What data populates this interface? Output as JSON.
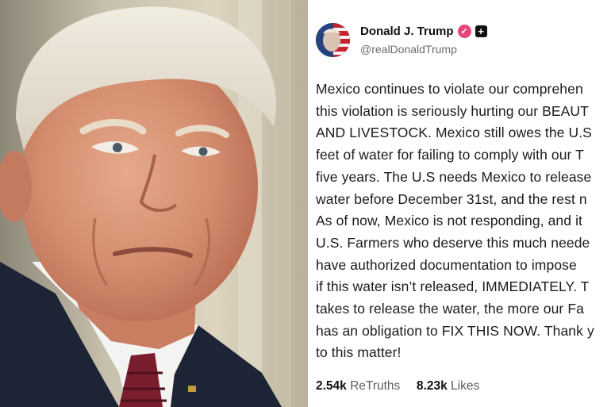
{
  "post": {
    "author_name": "Donald J. Trump",
    "handle": "@realDonaldTrump",
    "body_lines": [
      "Mexico continues to violate our comprehen",
      "this violation is seriously hurting our BEAUT",
      "AND LIVESTOCK. Mexico still owes the U.S",
      "feet of water for failing to comply with our T",
      "five years. The U.S needs Mexico to release",
      "water before December 31st, and the rest n",
      "As of now, Mexico is not responding, and it",
      "U.S. Farmers who deserve this much neede",
      "have authorized documentation to impose",
      "if this water isn’t released, IMMEDIATELY. T",
      "takes to release the water, the more our Fa",
      "has an obligation to FIX THIS NOW. Thank y",
      "to this matter!"
    ],
    "retruths_count": "2.54k",
    "retruths_label": "ReTruths",
    "likes_count": "8.23k",
    "likes_label": "Likes"
  },
  "icons": {
    "verified": "verified-badge-icon",
    "plus": "plus-badge-icon"
  },
  "colors": {
    "verified_badge": "#e6457a",
    "text_primary": "#1b1b1b",
    "text_secondary": "#6b6b6b"
  }
}
